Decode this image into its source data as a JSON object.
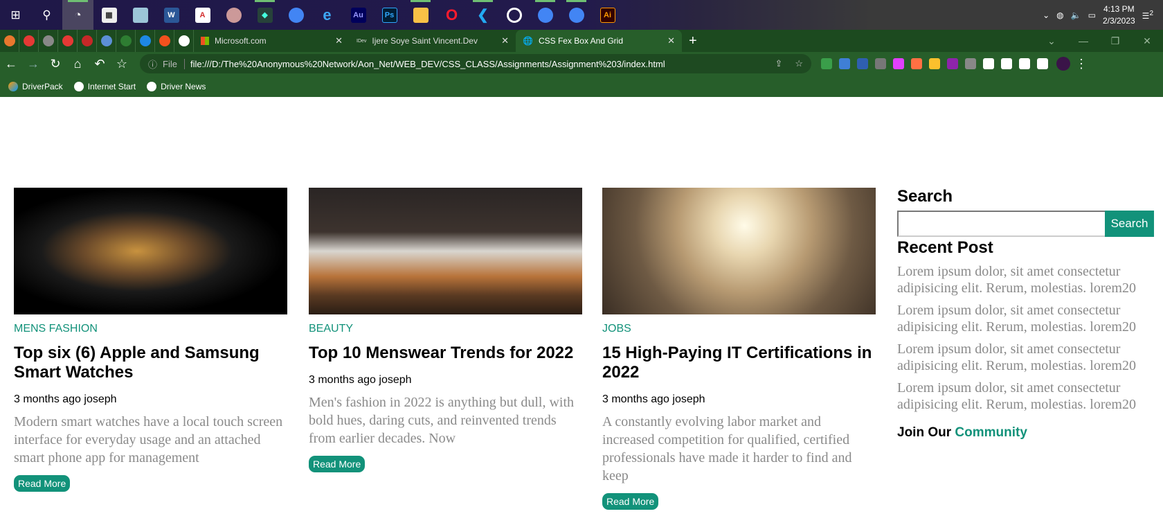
{
  "taskbar": {
    "apps": [
      "start",
      "search",
      "photos",
      "calculator",
      "notepad",
      "word",
      "acrobat",
      "paint",
      "filmora",
      "chrome-canary",
      "edge",
      "audition",
      "photoshop",
      "file-explorer",
      "opera",
      "vscode",
      "obs",
      "chrome",
      "chrome",
      "illustrator"
    ],
    "time": "4:13 PM",
    "date": "2/3/2023",
    "notifications": "2"
  },
  "browser": {
    "pinned_tabs": [
      "#e8772e",
      "#e53935",
      "#888",
      "#e53935",
      "#c62828",
      "#5c8fd6",
      "#2e7d32",
      "#1e88e5",
      "#f4511e",
      "#fff"
    ],
    "tabs": [
      {
        "label": "Microsoft.com",
        "icon": "microsoft-logo"
      },
      {
        "label": "Ijere Soye Saint Vincent.Dev",
        "icon": "dev-logo"
      },
      {
        "label": "CSS Fex Box And Grid",
        "icon": "globe-icon",
        "active": true
      }
    ],
    "file_label": "File",
    "url": "file:///D:/The%20Anonymous%20Network/Aon_Net/WEB_DEV/CSS_CLASS/Assignments/Assignment%203/index.html",
    "extensions": [
      "#3a9e4a",
      "#3f7fd6",
      "#2f5fb0",
      "#777",
      "#e040fb",
      "#ff7043",
      "#fbc02d",
      "#8e24aa",
      "#888",
      "#fff",
      "#fff",
      "#fff",
      "#fff"
    ],
    "bookmarks": [
      "DriverPack",
      "Internet Start",
      "Driver News"
    ]
  },
  "page": {
    "cards": [
      {
        "category": "MENS FASHION",
        "title": "Top six (6) Apple and Samsung Smart Watches",
        "meta": "3 months ago joseph",
        "excerpt": "Modern smart watches have a local touch screen interface for everyday usage and an attached smart phone app for management",
        "button": "Read More"
      },
      {
        "category": "BEAUTY",
        "title": "Top 10 Menswear Trends for 2022",
        "meta": "3 months ago joseph",
        "excerpt": "Men's fashion in 2022 is anything but dull, with bold hues, daring cuts, and reinvented trends from earlier decades. Now",
        "button": "Read More"
      },
      {
        "category": "JOBS",
        "title": "15 High-Paying IT Certifications in 2022",
        "meta": "3 months ago joseph",
        "excerpt": "A constantly evolving labor market and increased competition for qualified, certified professionals have made it harder to find and keep",
        "button": "Read More"
      }
    ],
    "sidebar": {
      "search_heading": "Search",
      "search_value": "",
      "search_button": "Search",
      "recent_heading": "Recent Post",
      "posts": [
        "Lorem ipsum dolor, sit amet consectetur adipisicing elit. Rerum, molestias. lorem20",
        "Lorem ipsum dolor, sit amet consectetur adipisicing elit. Rerum, molestias. lorem20",
        "Lorem ipsum dolor, sit amet consectetur adipisicing elit. Rerum, molestias. lorem20",
        "Lorem ipsum dolor, sit amet consectetur adipisicing elit. Rerum, molestias. lorem20"
      ],
      "join_prefix": "Join Our",
      "join_highlight": "Community"
    },
    "accent": "#12927a"
  }
}
